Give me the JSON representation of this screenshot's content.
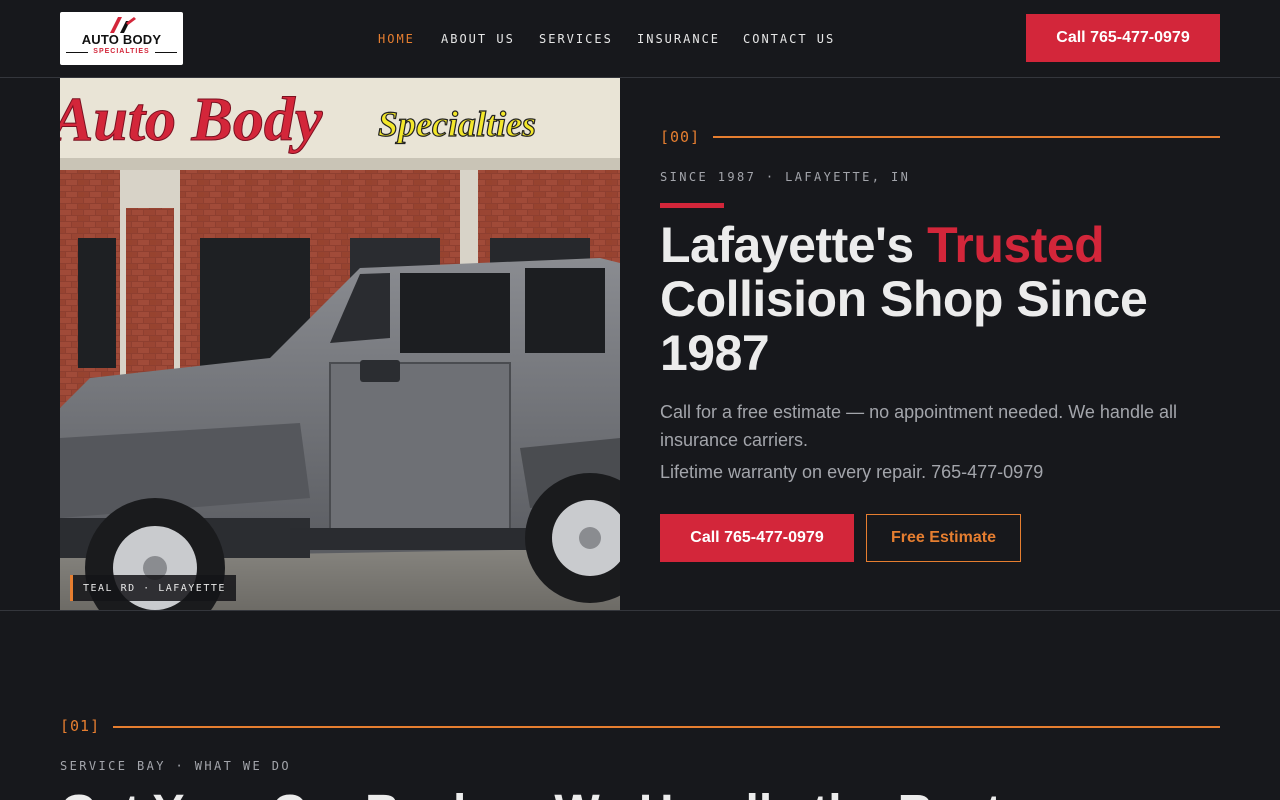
{
  "header": {
    "logo": {
      "line1": "AUTO BODY",
      "line2": "SPECIALTIES"
    },
    "nav": [
      {
        "label": "HOME",
        "active": true
      },
      {
        "label": "ABOUT US",
        "active": false
      },
      {
        "label": "SERVICES",
        "active": false
      },
      {
        "label": "INSURANCE",
        "active": false
      },
      {
        "label": "CONTACT US",
        "active": false
      }
    ],
    "cta_label": "Call 765-477-0979"
  },
  "hero": {
    "image": {
      "sign_left": "Auto Body",
      "sign_right": "Specialties",
      "caption": "TEAL RD · LAFAYETTE"
    },
    "section_number": "[00]",
    "eyebrow": "SINCE 1987 · LAFAYETTE, IN",
    "headline_before": "Lafayette's ",
    "headline_accent": "Trusted",
    "headline_after": " Collision Shop Since 1987",
    "lead_1": "Call for a free estimate — no appointment needed. We handle all insurance carriers.",
    "lead_2": "Lifetime warranty on every repair. 765-477-0979",
    "primary_cta": "Call 765-477-0979",
    "secondary_cta": "Free Estimate"
  },
  "services": {
    "section_number": "[01]",
    "eyebrow": "SERVICE BAY · WHAT WE DO",
    "heading": "Get Your Car Back — We Handle the Rest"
  },
  "colors": {
    "background": "#17181c",
    "brand_red": "#d3263a",
    "accent_orange": "#e67e30",
    "muted_text": "#a3a5ab"
  }
}
